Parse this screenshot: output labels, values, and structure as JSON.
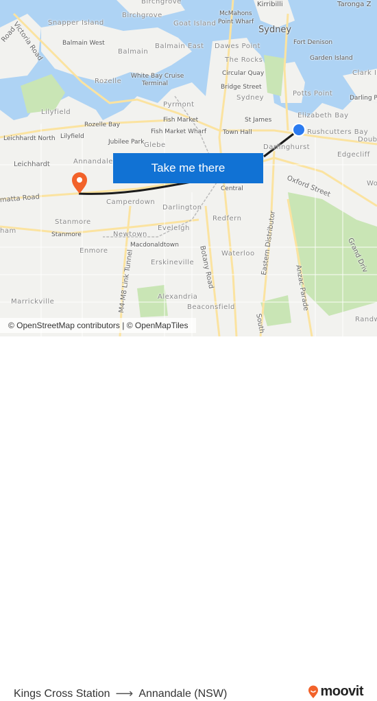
{
  "map": {
    "labels": [
      "Birchgrove",
      "Birchgrove",
      "Snapper Island",
      "Goat Island",
      "McMahons",
      "Point Wharf",
      "Sydney",
      "Kirribilli",
      "Taronga Z",
      "Victoria Road",
      "Road",
      "Balmain West",
      "Balmain East",
      "Dawes Point",
      "Fort Denison",
      "Balmain",
      "The Rocks",
      "Garden Island",
      "Circular Quay",
      "Clark I",
      "White Bay Cruise",
      "Terminal",
      "Rozelle",
      "Bridge Street",
      "Potts Point",
      "Sydney",
      "Darling Po",
      "Pyrmont",
      "Lilyfield",
      "Elizabeth Bay",
      "Fish Market",
      "St James",
      "Rozelle Bay",
      "Fish Market Wharf",
      "Town Hall",
      "Rushcutters Bay",
      "Leichhardt North",
      "Lilyfield",
      "Jubilee Park",
      "Glebe",
      "Darlinghurst",
      "Doub",
      "Edgecliff",
      "Leichhardt",
      "Annandale",
      "Oxford Street",
      "Wo",
      "Parramatta Road",
      "Central",
      "Camperdown",
      "Darlington",
      "Stanmore",
      "Redfern",
      "Eveleigh",
      "Grand Driv",
      "Newtown",
      "Macdonaldtown",
      "Stanmore",
      "Enmore",
      "Waterloo",
      "Eastern Distributor",
      "Botany Road",
      "M4-M8 Link Tunnel",
      "Erskineville",
      "Anzac Parade",
      "Alexandria",
      "Marrickville",
      "Beaconsfield",
      "South",
      "Randw",
      "ham"
    ],
    "origin_marker_color": "#2b7bf0",
    "destination_marker_color": "#f2622a",
    "route_color": "#1a1a1a",
    "water_color": "#aed3f4",
    "attribution": "© OpenStreetMap contributors | © OpenMapTiles"
  },
  "cta": {
    "label": "Take me there",
    "color": "#1172d4"
  },
  "footer": {
    "origin": "Kings Cross Station",
    "arrow_icon": "arrow-right-icon",
    "destination": "Annandale (NSW)",
    "logo_text": "moovit",
    "logo_color": "#f2622a"
  }
}
